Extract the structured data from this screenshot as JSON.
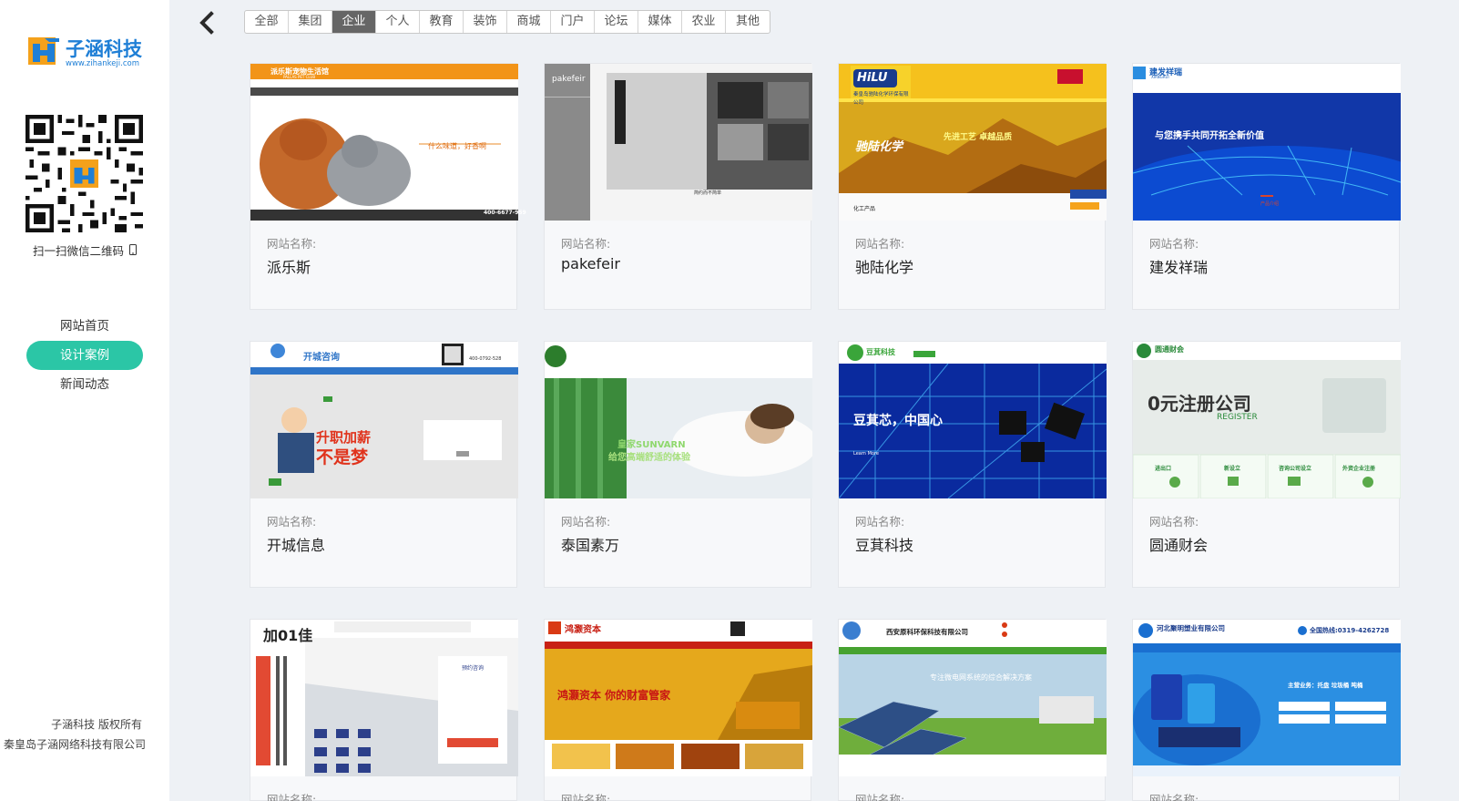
{
  "sidebar": {
    "brand_name": "子涵科技",
    "brand_url": "www.zihankeji.com",
    "qr_caption": "扫一扫微信二维码",
    "nav": [
      {
        "label": "网站首页",
        "active": false
      },
      {
        "label": "设计案例",
        "active": true
      },
      {
        "label": "新闻动态",
        "active": false
      }
    ],
    "copyright_line1": "子涵科技 版权所有",
    "copyright_line2": "秦皇岛子涵网络科技有限公司"
  },
  "filters": [
    {
      "label": "全部",
      "active": false
    },
    {
      "label": "集团",
      "active": false
    },
    {
      "label": "企业",
      "active": true
    },
    {
      "label": "个人",
      "active": false
    },
    {
      "label": "教育",
      "active": false
    },
    {
      "label": "装饰",
      "active": false
    },
    {
      "label": "商城",
      "active": false
    },
    {
      "label": "门户",
      "active": false
    },
    {
      "label": "论坛",
      "active": false
    },
    {
      "label": "媒体",
      "active": false
    },
    {
      "label": "农业",
      "active": false
    },
    {
      "label": "其他",
      "active": false
    }
  ],
  "card_label": "网站名称:",
  "cards": [
    {
      "name": "派乐斯",
      "thumb_title": "派乐斯宠物生活馆",
      "thumb_sub": "PALLAS PET CLUB",
      "thumb_slogan": "什么味道，好香啊",
      "thumb_phone": "400-6677-959"
    },
    {
      "name": "pakefeir",
      "thumb_title": "pakefeir",
      "thumb_sub": "简约而不简单"
    },
    {
      "name": "驰陆化学",
      "thumb_title": "HiLU",
      "thumb_sub": "秦皇岛驰陆化学环保有限公司",
      "thumb_slogan": "驰陆化学",
      "thumb_slogan2": "先进工艺 卓越品质",
      "thumb_extra": "化工产品"
    },
    {
      "name": "建发祥瑞",
      "thumb_title": "建发祥瑞",
      "thumb_sub": "XIANGRUI",
      "thumb_slogan": "与您携手共同开拓全新价值",
      "thumb_extra": "产品介绍"
    },
    {
      "name": "开城信息",
      "thumb_title": "开城咨询",
      "thumb_phone": "400-0792-528",
      "thumb_slogan": "升职加薪",
      "thumb_slogan2": "不是梦"
    },
    {
      "name": "泰国素万",
      "thumb_title": "皇家SUNVARN",
      "thumb_sub": "给您高端舒适的体验"
    },
    {
      "name": "豆萁科技",
      "thumb_title": "豆萁科技",
      "thumb_slogan": "豆萁芯，中国心",
      "thumb_sub": "Learn More"
    },
    {
      "name": "圆通财会",
      "thumb_title": "圆通财会",
      "thumb_slogan": "0元注册公司",
      "thumb_sub": "REGISTER",
      "thumb_items": [
        "进出口",
        "新设立",
        "咨询公司设立",
        "外资企业注册"
      ]
    },
    {
      "name": "",
      "thumb_title": "加01佳",
      "thumb_sub": "预约咨询"
    },
    {
      "name": "",
      "thumb_title": "鸿灏资本",
      "thumb_slogan": "鸿灏资本 你的财富管家"
    },
    {
      "name": "",
      "thumb_title": "西安原科环保科技有限公司",
      "thumb_slogan": "专注微电网系统的综合解决方案"
    },
    {
      "name": "",
      "thumb_title": "河北聚明塑业有限公司",
      "thumb_phone": "全国热线:0319-4262728",
      "thumb_slogan": "主营业务：托盘 垃圾桶 吨桶"
    }
  ],
  "colors": {
    "accent": "#2bc6a6",
    "brand": "#1f7fd6",
    "page_bg": "#eef1f5",
    "active_tab": "#666666"
  },
  "icons": [
    "zihan-logo-icon",
    "qr-code-icon",
    "phone-icon",
    "chevron-left-icon"
  ]
}
